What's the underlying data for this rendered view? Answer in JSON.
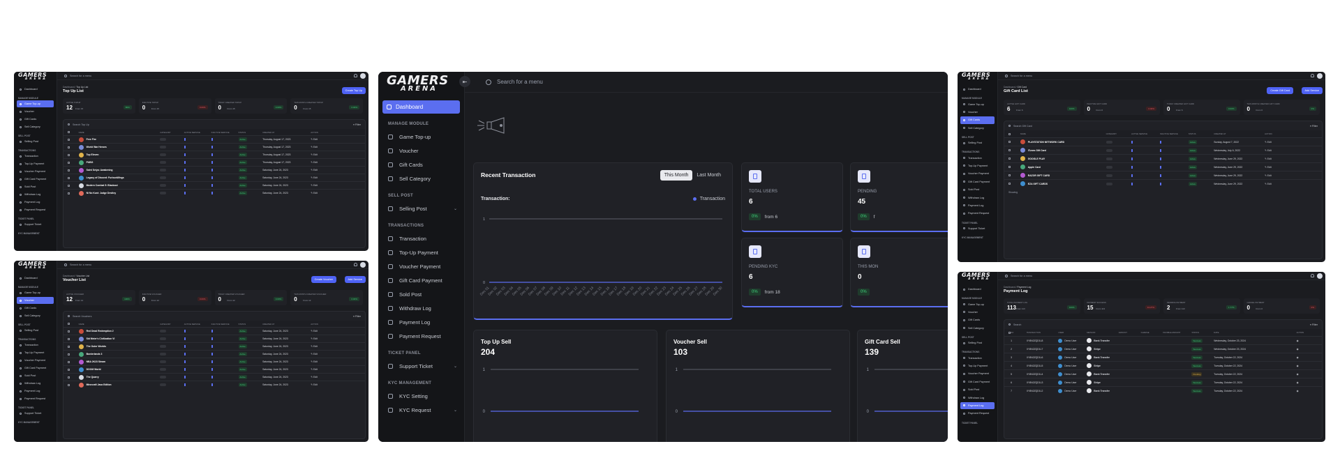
{
  "brand": {
    "logo_main": "GAMERS",
    "logo_sub": "ARENA"
  },
  "main": {
    "search_placeholder": "Search for a menu",
    "collapse_icon": "sidebar-toggle-icon",
    "sidebar": {
      "dashboard": "Dashboard",
      "sections": [
        {
          "title": "MANAGE MODULE",
          "items": [
            "Game Top-up",
            "Voucher",
            "Gift Cards",
            "Sell Category"
          ]
        },
        {
          "title": "SELL POST",
          "items": [
            "Selling Post"
          ]
        },
        {
          "title": "TRANSACTIONS",
          "items": [
            "Transaction",
            "Top-Up Payment",
            "Voucher Payment",
            "Gift Card Payment",
            "Sold Post",
            "Withdraw Log",
            "Payment Log",
            "Payment Request"
          ]
        },
        {
          "title": "TICKET PANEL",
          "items": [
            "Support Ticket"
          ]
        },
        {
          "title": "KYC MANAGEMENT",
          "items": [
            "KYC Setting",
            "KYC Request"
          ]
        }
      ]
    },
    "recent": {
      "title": "Recent Transaction",
      "tabs": [
        "This Month",
        "Last Month"
      ],
      "subtitle": "Transaction:",
      "legend": "Transaction",
      "y_ticks": [
        "1",
        "0"
      ],
      "dates": [
        "Dec 01",
        "Dec 02",
        "Dec 03",
        "Dec 04",
        "Dec 05",
        "Dec 06",
        "Dec 07",
        "Dec 08",
        "Dec 09",
        "Dec 10",
        "Dec 11",
        "Dec 12",
        "Dec 13",
        "Dec 14",
        "Dec 15",
        "Dec 16",
        "Dec 17",
        "Dec 18",
        "Dec 19",
        "Dec 20",
        "Dec 21",
        "Dec 22",
        "Dec 23",
        "Dec 24",
        "Dec 25",
        "Dec 26",
        "Dec 27",
        "Dec 28",
        "Dec 29",
        "Dec 30"
      ]
    },
    "kpis": [
      {
        "label": "TOTAL USERS",
        "value": "6",
        "badge": "0%",
        "from": "from 6"
      },
      {
        "label": "PENDING",
        "value": "45",
        "badge": "0%",
        "from": "f"
      },
      {
        "label": "PENDING KYC",
        "value": "6",
        "badge": "0%",
        "from": "from 18"
      },
      {
        "label": "THIS MON",
        "value": "0",
        "badge": "0%",
        "from": ""
      }
    ],
    "sells": [
      {
        "title": "Top Up Sell",
        "value": "204"
      },
      {
        "title": "Voucher Sell",
        "value": "103"
      },
      {
        "title": "Gift Card Sell",
        "value": "139"
      }
    ],
    "sell_ticks": [
      "1",
      "0"
    ]
  },
  "topup": {
    "breadcrumb": "Dashboard",
    "crumb2": "Top Up List",
    "title": "Top Up List",
    "create_btn": "Create Top Up",
    "search_ph": "Search for a menu",
    "stats": [
      {
        "label": "ACTIVE TOPUP",
        "value": "12",
        "from": "From 15",
        "badge": "80%"
      },
      {
        "label": "INACTIVE TOPUP",
        "value": "0",
        "from": "From 15",
        "badge": "0.00%"
      },
      {
        "label": "TODAY CREATED TOPUP",
        "value": "0",
        "from": "From 15",
        "badge": "0.00%"
      },
      {
        "label": "THIS MONTH CREATED TOPUP",
        "value": "0",
        "from": "From 15",
        "badge": "0.00%"
      }
    ],
    "table_search": "Search Top Up",
    "filter": "Filter",
    "cols": [
      "NAME",
      "CATEGORY",
      "ACTIVE SERVICE",
      "INACTIVE SERVICE",
      "STATUS",
      "CREATED AT",
      "ACTION"
    ],
    "rows": [
      {
        "name": "Free Fire",
        "date": "Thursday, August 17, 2023"
      },
      {
        "name": "World War Heroes",
        "date": "Thursday, August 17, 2023"
      },
      {
        "name": "Top Eleven",
        "date": "Thursday, August 17, 2023"
      },
      {
        "name": "PUBG",
        "date": "Thursday, August 17, 2023"
      },
      {
        "name": "Saint Seiya: Awakening",
        "date": "Saturday, June 24, 2023"
      },
      {
        "name": "Legacy of Discord: FuriousWings",
        "date": "Saturday, June 24, 2023"
      },
      {
        "name": "Modern Combat 5: Blackout",
        "date": "Saturday, June 24, 2023"
      },
      {
        "name": "Ni No Kuni: Judge Destiny",
        "date": "Saturday, June 24, 2023"
      }
    ],
    "status": "Active",
    "action": "Edit",
    "sidebar": [
      "Dashboard",
      "MANAGE MODULE",
      "Game Top-up",
      "Voucher",
      "Gift Cards",
      "Sell Category",
      "SELL POST",
      "Selling Post",
      "TRANSACTIONS",
      "Transaction",
      "Top-Up Payment",
      "Voucher Payment",
      "Gift Card Payment",
      "Sold Post",
      "Withdraw Log",
      "Payment Log",
      "Payment Request",
      "TICKET PANEL",
      "Support Ticket",
      "KYC MANAGEMENT"
    ]
  },
  "voucher": {
    "breadcrumb": "Dashboard",
    "crumb2": "Voucher List",
    "title": "Voucher List",
    "create_btn": "Create Voucher",
    "add_btn": "Add Service",
    "search_ph": "Search for a menu",
    "stats": [
      {
        "label": "ACTIVE VOUCHER",
        "value": "12",
        "from": "From 12",
        "badge": "100%"
      },
      {
        "label": "INACTIVE VOUCHER",
        "value": "0",
        "from": "From 12",
        "badge": "0.00%"
      },
      {
        "label": "TODAY CREATED VOUCHER",
        "value": "0",
        "from": "From 12",
        "badge": "0.00%"
      },
      {
        "label": "THIS MONTH CREATED VOUCHER",
        "value": "0",
        "from": "From 12",
        "badge": "0.00%"
      }
    ],
    "table_search": "Search Vouchers",
    "filter": "Filter",
    "cols": [
      "NAME",
      "CATEGORY",
      "ACTIVE SERVICE",
      "INACTIVE SERVICE",
      "STATUS",
      "CREATED AT",
      "ACTION"
    ],
    "rows": [
      {
        "name": "Red Dead Redemption 2",
        "date": "Saturday, June 24, 2023"
      },
      {
        "name": "Sid Meier's Civilization VI",
        "date": "Saturday, June 24, 2023"
      },
      {
        "name": "The Outer Worlds",
        "date": "Saturday, June 24, 2023"
      },
      {
        "name": "Borderlands 3",
        "date": "Saturday, June 24, 2023"
      },
      {
        "name": "NBA 2K23 Steam",
        "date": "Saturday, June 24, 2023"
      },
      {
        "name": "DOOM World",
        "date": "Saturday, June 24, 2023"
      },
      {
        "name": "The Quarry",
        "date": "Saturday, June 24, 2023"
      },
      {
        "name": "Minecraft Java Edition",
        "date": "Saturday, June 24, 2023"
      }
    ],
    "status": "Active",
    "action": "Edit",
    "sidebar": [
      "Dashboard",
      "MANAGE MODULE",
      "Game Top-up",
      "Voucher",
      "Gift Cards",
      "Sell Category",
      "SELL POST",
      "Selling Post",
      "TRANSACTIONS",
      "Transaction",
      "Top-Up Payment",
      "Voucher Payment",
      "Gift Card Payment",
      "Sold Post",
      "Withdraw Log",
      "Payment Log",
      "Payment Request",
      "TICKET PANEL",
      "Support Ticket",
      "KYC MANAGEMENT"
    ]
  },
  "giftcard": {
    "breadcrumb": "Dashboard",
    "crumb2": "Gift Card",
    "title": "Gift Card List",
    "create_btn": "Create Gift Card",
    "add_btn": "Add Service",
    "search_ph": "Search for a menu",
    "stats": [
      {
        "label": "ACTIVE GIFT CARD",
        "value": "6",
        "from": "From 6",
        "badge": "100%"
      },
      {
        "label": "INACTIVE GIFT CARD",
        "value": "0",
        "from": "From 6",
        "badge": "0.00%"
      },
      {
        "label": "TODAY CREATED GIFT CARD",
        "value": "0",
        "from": "From 6",
        "badge": "0.00%"
      },
      {
        "label": "THIS MONTH CREATED GIFT CARD",
        "value": "0",
        "from": "From 6",
        "badge": "0%"
      }
    ],
    "table_search": "Search Gift Card",
    "filter": "Filter",
    "cols": [
      "NAME",
      "CATEGORY",
      "ACTIVE SERVICE",
      "INACTIVE SERVICE",
      "STATUS",
      "CREATED AT",
      "ACTION"
    ],
    "rows": [
      {
        "name": "PLAYSTATION NETWORK CARD",
        "date": "Sunday, August 7, 2022"
      },
      {
        "name": "iTunes Gift Card",
        "date": "Wednesday, July 6, 2022"
      },
      {
        "name": "GOOGLE PLAY",
        "date": "Wednesday, June 29, 2022"
      },
      {
        "name": "Apple Card",
        "date": "Wednesday, June 29, 2022"
      },
      {
        "name": "RAZOR GIFT CARD",
        "date": "Wednesday, June 29, 2022"
      },
      {
        "name": "EZA GIFT CARDS",
        "date": "Wednesday, June 29, 2022"
      }
    ],
    "status": "Active",
    "action": "Edit",
    "showing": "Showing",
    "sidebar": [
      "Dashboard",
      "MANAGE MODULE",
      "Game Top-up",
      "Voucher",
      "Gift Cards",
      "Sell Category",
      "SELL POST",
      "Selling Post",
      "TRANSACTIONS",
      "Transaction",
      "Top-Up Payment",
      "Voucher Payment",
      "Gift Card Payment",
      "Sold Post",
      "Withdraw Log",
      "Payment Log",
      "Payment Request",
      "TICKET PANEL",
      "Support Ticket",
      "KYC MANAGEMENT"
    ]
  },
  "paylog": {
    "breadcrumb": "Dashboard",
    "crumb2": "Payment Log",
    "title": "Payment Log",
    "search_ph": "Search for a menu",
    "stats": [
      {
        "label": "TOTAL PAYMENT LOG",
        "value": "113",
        "from": "From 113",
        "badge": "100%"
      },
      {
        "label": "PAYMENT SUCCESS",
        "value": "15",
        "from": "From 113",
        "badge": "13.27%"
      },
      {
        "label": "PENDING PAYMENT",
        "value": "2",
        "from": "From 113",
        "badge": "1.77%"
      },
      {
        "label": "CANCEL PAYMENT",
        "value": "0",
        "from": "From 0",
        "badge": "0%"
      }
    ],
    "table_search": "Search",
    "filter": "Filter",
    "cols": [
      "NO",
      "TRANSACTION",
      "USER",
      "METHOD",
      "AMOUNT",
      "CHARGE",
      "PAYABLE AMOUNT",
      "STATUS",
      "DATE",
      "ACTION"
    ],
    "rows": [
      {
        "no": "1",
        "trx": "XY8N2ZQD1L8",
        "user": "Demo User",
        "method": "Bank Transfer",
        "status": "Success",
        "date": "Wednesday, October 23, 2024"
      },
      {
        "no": "2",
        "trx": "XY8N2ZQD1L7",
        "user": "Demo User",
        "method": "Stripe",
        "status": "Success",
        "date": "Wednesday, October 23, 2024"
      },
      {
        "no": "3",
        "trx": "XY8N2ZQD1L6",
        "user": "Demo User",
        "method": "Bank Transfer",
        "status": "Success",
        "date": "Tuesday, October 22, 2024"
      },
      {
        "no": "4",
        "trx": "XY8N2ZQD1L5",
        "user": "Demo User",
        "method": "Stripe",
        "status": "Success",
        "date": "Tuesday, October 22, 2024"
      },
      {
        "no": "5",
        "trx": "XY8N2ZQD1L4",
        "user": "Demo User",
        "method": "Bank Transfer",
        "status": "Pending",
        "date": "Tuesday, October 22, 2024"
      },
      {
        "no": "6",
        "trx": "XY8N2ZQD1L3",
        "user": "Demo User",
        "method": "Stripe",
        "status": "Success",
        "date": "Tuesday, October 22, 2024"
      },
      {
        "no": "7",
        "trx": "XY8N2ZQD1L2",
        "user": "Demo User",
        "method": "Bank Transfer",
        "status": "Success",
        "date": "Tuesday, October 22, 2024"
      }
    ],
    "sidebar": [
      "Dashboard",
      "MANAGE MODULE",
      "Game Top-up",
      "Voucher",
      "Gift Cards",
      "Sell Category",
      "SELL POST",
      "Selling Post",
      "TRANSACTIONS",
      "Transaction",
      "Top-Up Payment",
      "Voucher Payment",
      "Gift Card Payment",
      "Sold Post",
      "Withdraw Log",
      "Payment Log",
      "Payment Request",
      "TICKET PANEL"
    ]
  },
  "colors": {
    "accent": "#5b6ef0",
    "success": "#3fd27b",
    "danger": "#f1555f",
    "bg": "#1b1c20",
    "sidebar": "#141518"
  }
}
